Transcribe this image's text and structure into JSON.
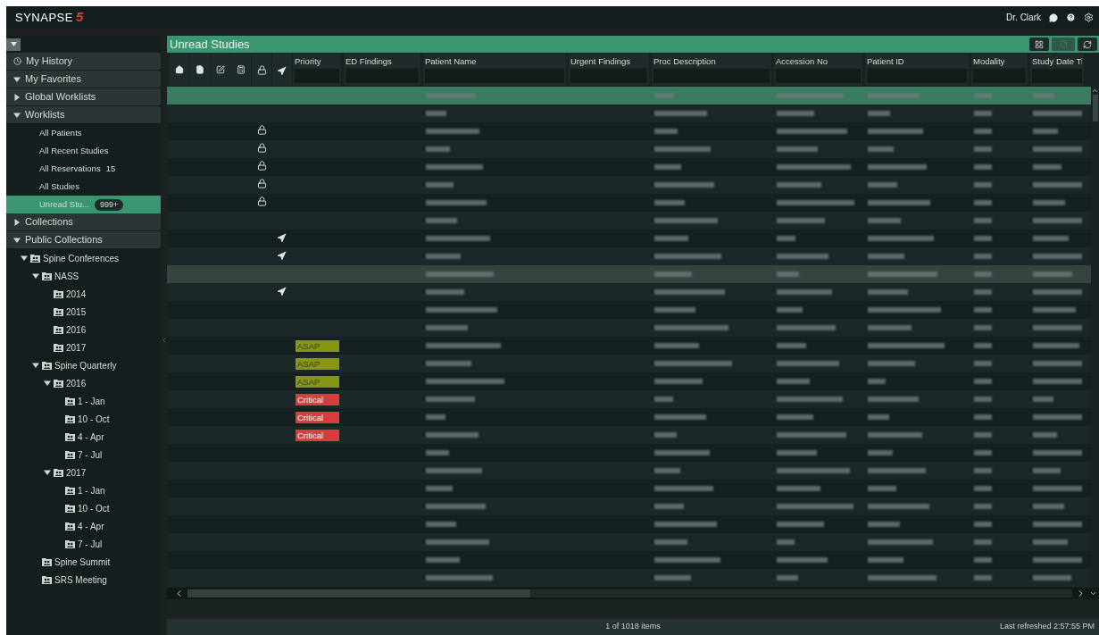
{
  "top_bar": {
    "logo": "SYNAPSE",
    "logo_mark": "5",
    "user": "Dr. Clark"
  },
  "sidebar": {
    "sections": [
      {
        "kind": "history",
        "label": "My History"
      },
      {
        "kind": "group",
        "label": "My Favorites",
        "expanded": true
      },
      {
        "kind": "group",
        "label": "Global Worklists",
        "expanded": false
      },
      {
        "kind": "group",
        "label": "Worklists",
        "expanded": true,
        "items": [
          {
            "label": "All Patients",
            "selected": false
          },
          {
            "label": "All Recent Studies",
            "selected": false
          },
          {
            "label": "All Reservations",
            "count": "15",
            "selected": false
          },
          {
            "label": "All Studies",
            "selected": false
          },
          {
            "label": "Unread Stu...",
            "badge": "999+",
            "selected": true
          }
        ]
      },
      {
        "kind": "group",
        "label": "Collections",
        "expanded": false
      },
      {
        "kind": "group",
        "label": "Public Collections",
        "expanded": true,
        "tree": [
          {
            "label": "Spine Conferences",
            "expanded": true,
            "children": [
              {
                "label": "NASS",
                "expanded": true,
                "children": [
                  {
                    "label": "2014"
                  },
                  {
                    "label": "2015"
                  },
                  {
                    "label": "2016"
                  },
                  {
                    "label": "2017"
                  }
                ]
              },
              {
                "label": "Spine Quarterly",
                "expanded": true,
                "children": [
                  {
                    "label": "2016",
                    "expanded": true,
                    "children": [
                      {
                        "label": "1 - Jan"
                      },
                      {
                        "label": "10 - Oct"
                      },
                      {
                        "label": "4 - Apr"
                      },
                      {
                        "label": "7 - Jul"
                      }
                    ]
                  },
                  {
                    "label": "2017",
                    "expanded": true,
                    "children": [
                      {
                        "label": "1 - Jan"
                      },
                      {
                        "label": "10 - Oct"
                      },
                      {
                        "label": "4 - Apr"
                      },
                      {
                        "label": "7 - Jul"
                      }
                    ]
                  }
                ]
              },
              {
                "label": "Spine Summit"
              },
              {
                "label": "SRS Meeting"
              }
            ]
          }
        ]
      }
    ]
  },
  "worklist": {
    "title": "Unread Studies",
    "columns": [
      {
        "label": "Priority"
      },
      {
        "label": "ED Findings"
      },
      {
        "label": "Patient Name"
      },
      {
        "label": "Urgent Findings"
      },
      {
        "label": "Proc Description"
      },
      {
        "label": "Accession No"
      },
      {
        "label": "Patient ID"
      },
      {
        "label": "Modality"
      },
      {
        "label": "Study Date Ti"
      }
    ],
    "rows": [
      {
        "selected": true,
        "hovered": false,
        "locked": false,
        "flagged": false
      },
      {
        "selected": false,
        "hovered": false,
        "locked": false,
        "flagged": false
      },
      {
        "selected": false,
        "hovered": false,
        "locked": true,
        "flagged": false
      },
      {
        "selected": false,
        "hovered": false,
        "locked": true,
        "flagged": false
      },
      {
        "selected": false,
        "hovered": false,
        "locked": true,
        "flagged": false
      },
      {
        "selected": false,
        "hovered": false,
        "locked": true,
        "flagged": false
      },
      {
        "selected": false,
        "hovered": false,
        "locked": true,
        "flagged": false
      },
      {
        "selected": false,
        "hovered": false,
        "locked": false,
        "flagged": false
      },
      {
        "selected": false,
        "hovered": false,
        "locked": false,
        "flagged": true
      },
      {
        "selected": false,
        "hovered": false,
        "locked": false,
        "flagged": true
      },
      {
        "selected": false,
        "hovered": true,
        "locked": false,
        "flagged": false
      },
      {
        "selected": false,
        "hovered": false,
        "locked": false,
        "flagged": true
      },
      {
        "selected": false,
        "hovered": false,
        "locked": false,
        "flagged": false
      },
      {
        "selected": false,
        "hovered": false,
        "locked": false,
        "flagged": false
      },
      {
        "selected": false,
        "hovered": false,
        "locked": false,
        "flagged": false,
        "priority": {
          "label": "ASAP",
          "color": "#879614"
        }
      },
      {
        "selected": false,
        "hovered": false,
        "locked": false,
        "flagged": false,
        "priority": {
          "label": "ASAP",
          "color": "#879614"
        }
      },
      {
        "selected": false,
        "hovered": false,
        "locked": false,
        "flagged": false,
        "priority": {
          "label": "ASAP",
          "color": "#879614"
        }
      },
      {
        "selected": false,
        "hovered": false,
        "locked": false,
        "flagged": false,
        "priority": {
          "label": "Critical",
          "color": "#d83c3c"
        }
      },
      {
        "selected": false,
        "hovered": false,
        "locked": false,
        "flagged": false,
        "priority": {
          "label": "Critical",
          "color": "#d83c3c"
        }
      },
      {
        "selected": false,
        "hovered": false,
        "locked": false,
        "flagged": false,
        "priority": {
          "label": "Critical",
          "color": "#d83c3c"
        }
      },
      {
        "selected": false,
        "hovered": false,
        "locked": false,
        "flagged": false
      },
      {
        "selected": false,
        "hovered": false,
        "locked": false,
        "flagged": false
      },
      {
        "selected": false,
        "hovered": false,
        "locked": false,
        "flagged": false
      },
      {
        "selected": false,
        "hovered": false,
        "locked": false,
        "flagged": false
      },
      {
        "selected": false,
        "hovered": false,
        "locked": false,
        "flagged": false
      },
      {
        "selected": false,
        "hovered": false,
        "locked": false,
        "flagged": false
      },
      {
        "selected": false,
        "hovered": false,
        "locked": false,
        "flagged": false
      },
      {
        "selected": false,
        "hovered": false,
        "locked": false,
        "flagged": false
      }
    ],
    "item_count": "1 of 1018 items",
    "last_refreshed": "Last refreshed 2:57:55 PM"
  }
}
